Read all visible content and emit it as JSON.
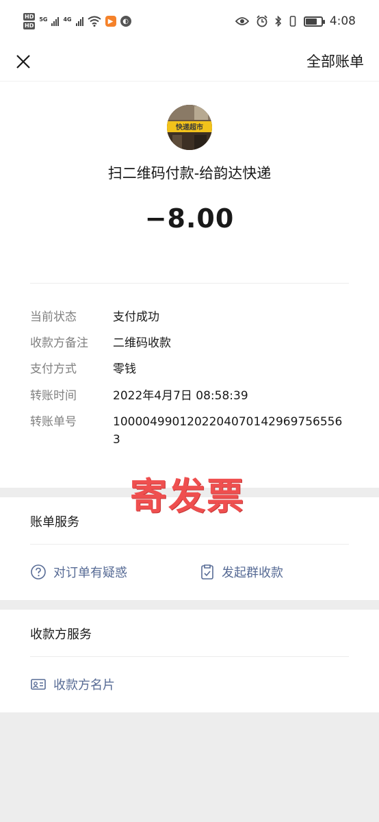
{
  "status_bar": {
    "hd1": "HD",
    "hd2": "HD",
    "net1": "5G",
    "net2": "4G",
    "time": "4:08",
    "battery_level": 0.75
  },
  "navbar": {
    "all_bills_label": "全部账单"
  },
  "transaction": {
    "merchant_name": "扫二维码付款-给韵达快递",
    "amount": "−8.00",
    "avatar_sign_text": "快递超市",
    "details": [
      {
        "label": "当前状态",
        "value": "支付成功"
      },
      {
        "label": "收款方备注",
        "value": "二维码收款"
      },
      {
        "label": "支付方式",
        "value": "零钱"
      },
      {
        "label": "转账时间",
        "value": "2022年4月7日 08:58:39"
      },
      {
        "label": "转账单号",
        "value": "10000499012022040701429697565563"
      }
    ]
  },
  "watermark_text": "寄发票",
  "bill_service": {
    "title": "账单服务",
    "question_label": "对订单有疑惑",
    "group_collect_label": "发起群收款"
  },
  "payee_service": {
    "title": "收款方服务",
    "card_label": "收款方名片"
  },
  "colors": {
    "link": "#576b95",
    "watermark": "#ef4f4f",
    "background": "#ededed"
  }
}
